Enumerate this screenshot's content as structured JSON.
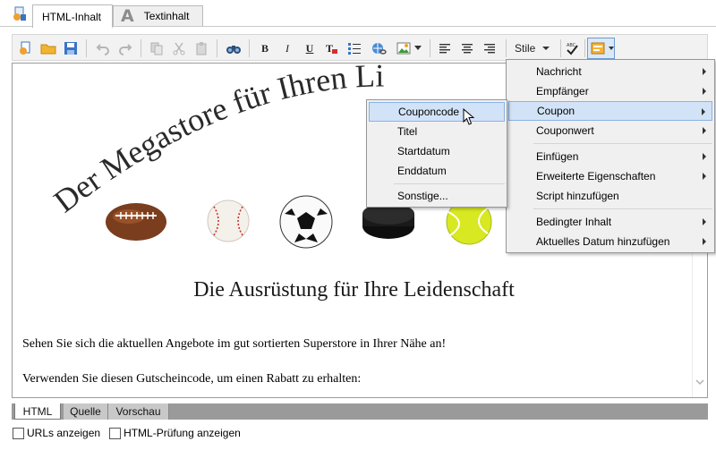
{
  "tabs": [
    {
      "label": "HTML-Inhalt",
      "active": true,
      "icon": "html-document-icon"
    },
    {
      "label": "Textinhalt",
      "active": false,
      "icon": "letter-a-icon"
    }
  ],
  "toolbar": {
    "bold_label": "B",
    "italic_label": "I",
    "underline_label": "U",
    "styles_label": "Stile"
  },
  "editor": {
    "arc_title": "Der Megastore für Ihren Li",
    "headline": "Die Ausrüstung für Ihre Leidenschaft",
    "paragraph_1": "Sehen Sie sich die aktuellen Angebote im gut sortierten Superstore in Ihrer Nähe an!",
    "paragraph_2": "Verwenden Sie diesen Gutscheincode, um einen Rabatt zu erhalten:"
  },
  "bottom_tabs": [
    {
      "label": "HTML",
      "active": true
    },
    {
      "label": "Quelle",
      "active": false
    },
    {
      "label": "Vorschau",
      "active": false
    }
  ],
  "options": {
    "show_urls": "URLs anzeigen",
    "html_check": "HTML-Prüfung anzeigen"
  },
  "context_menu": {
    "items": [
      {
        "label": "Nachricht",
        "submenu": true
      },
      {
        "label": "Empfänger",
        "submenu": true
      },
      {
        "label": "Coupon",
        "submenu": true,
        "highlighted": true
      },
      {
        "label": "Couponwert",
        "submenu": true
      },
      {
        "label": "Einfügen",
        "submenu": true
      },
      {
        "label": "Erweiterte Eigenschaften",
        "submenu": true
      },
      {
        "label": "Script hinzufügen",
        "submenu": false
      },
      {
        "label": "Bedingter Inhalt",
        "submenu": true
      },
      {
        "label": "Aktuelles Datum hinzufügen",
        "submenu": true
      }
    ]
  },
  "coupon_submenu": {
    "items": [
      {
        "label": "Couponcode",
        "highlighted": true
      },
      {
        "label": "Titel"
      },
      {
        "label": "Startdatum"
      },
      {
        "label": "Enddatum"
      },
      {
        "label": "Sonstige..."
      }
    ]
  },
  "colors": {
    "accent": "#88b3e6",
    "highlight": "#d2e3f7",
    "bottom_bar": "#9a9a9a"
  }
}
